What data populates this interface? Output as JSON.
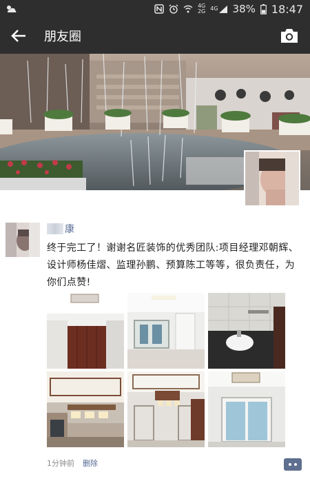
{
  "status_bar": {
    "network_top": "4G",
    "network_bottom": "2G",
    "network_label": "4G",
    "battery": "38%",
    "time": "18:47"
  },
  "header": {
    "title": "朋友圈",
    "back_icon": "arrow-left-icon",
    "camera_icon": "camera-icon"
  },
  "post": {
    "author_suffix": "康",
    "text": "终于完工了！谢谢名匠装饰的优秀团队:项目经理邓朝辉、设计师杨佳熠、监理孙鹏、预算陈工等等，很负责任，为你们点赞!",
    "timestamp": "1分钟前",
    "delete_label": "删除",
    "photo_count": 6
  },
  "colors": {
    "bar_bg": "#2e2e2e",
    "link": "#576b95",
    "text": "#222222",
    "muted": "#8a8a8a"
  }
}
